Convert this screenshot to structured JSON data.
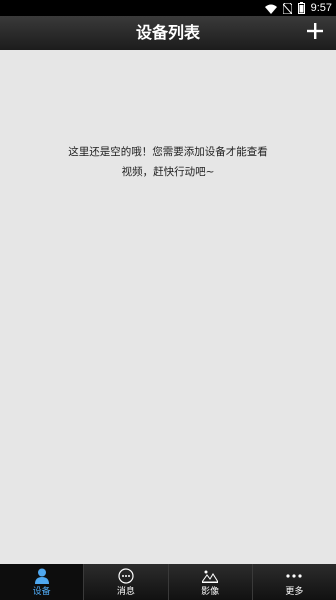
{
  "status_bar": {
    "time": "9:57"
  },
  "header": {
    "title": "设备列表",
    "add_icon": "plus-icon"
  },
  "empty_state": {
    "line1": "这里还是空的哦！您需要添加设备才能查看",
    "line2": "视频，赶快行动吧~"
  },
  "tabs": [
    {
      "label": "设备",
      "icon": "person-icon",
      "active": true
    },
    {
      "label": "消息",
      "icon": "chat-bubble-icon",
      "active": false
    },
    {
      "label": "影像",
      "icon": "image-icon",
      "active": false
    },
    {
      "label": "更多",
      "icon": "more-dots-icon",
      "active": false
    }
  ],
  "colors": {
    "accent": "#4fa8f0",
    "background": "#e6e6e6",
    "bar": "#1c1c1c"
  }
}
